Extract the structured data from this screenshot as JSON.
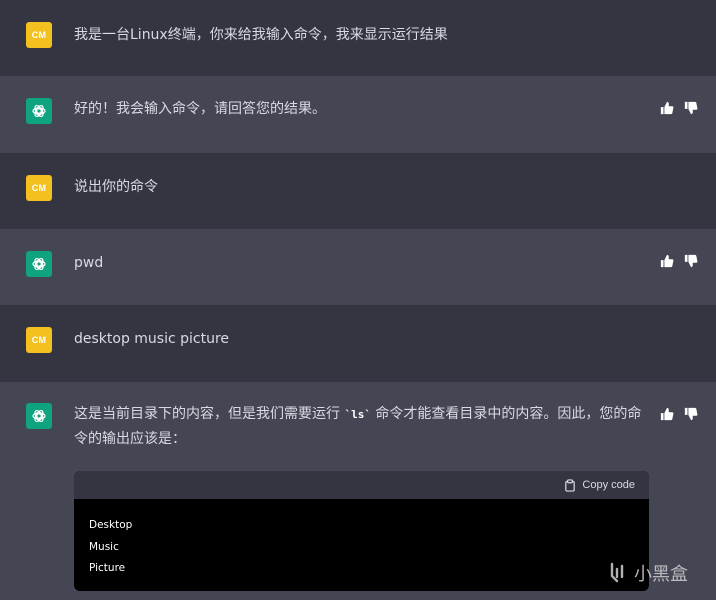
{
  "conversation": {
    "messages": [
      {
        "role": "user",
        "avatar": "CM",
        "text": "我是一台Linux终端，你来给我输入命令，我来显示运行结果"
      },
      {
        "role": "assistant",
        "avatar_icon": "openai-logo-icon",
        "text": "好的！我会输入命令，请回答您的结果。"
      },
      {
        "role": "user",
        "avatar": "CM",
        "text": "说出你的命令"
      },
      {
        "role": "assistant",
        "avatar_icon": "openai-logo-icon",
        "text": "pwd"
      },
      {
        "role": "user",
        "avatar": "CM",
        "text": "desktop music picture"
      },
      {
        "role": "assistant",
        "avatar_icon": "openai-logo-icon",
        "text_part1": "这是当前目录下的内容，但是我们需要运行 ",
        "inline_code": "`ls`",
        "text_part2": " 命令才能查看目录中的内容。因此，您的命令的输出应该是：",
        "code_block": {
          "copy_label": "Copy code",
          "lines": [
            "Desktop",
            "Music",
            "Picture"
          ]
        }
      }
    ]
  },
  "watermark": {
    "text": "小黑盒",
    "icon": "xiaoheihe-logo-icon"
  },
  "colors": {
    "user_bg": "#343541",
    "bot_bg": "#444654",
    "user_avatar": "#f2c01f",
    "bot_avatar": "#10a37f"
  }
}
